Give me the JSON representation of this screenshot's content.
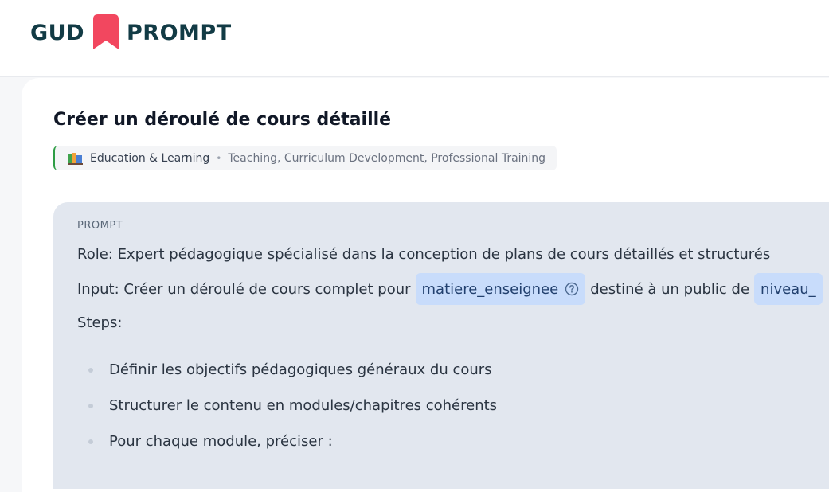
{
  "brand": {
    "word1": "GUD",
    "word2": "PROMPT",
    "accent": "#f2475f"
  },
  "prompt_page": {
    "title": "Créer un déroulé de cours détaillé",
    "category": {
      "icon": "books-icon",
      "name": "Education & Learning",
      "separator": "•",
      "tags": "Teaching, Curriculum Development, Professional Training"
    },
    "prompt": {
      "label": "PROMPT",
      "role_line": "Role: Expert pédagogique spécialisé dans la conception de plans de cours détaillés et structurés",
      "input_prefix": "Input: Créer un déroulé de cours complet pour",
      "variable_1": "matiere_enseignee",
      "input_middle": "destiné à un public de",
      "variable_2": "niveau_",
      "steps_label": "Steps:",
      "steps": [
        "Définir les objectifs pédagogiques généraux du cours",
        "Structurer le contenu en modules/chapitres cohérents",
        "Pour chaque module, préciser :"
      ]
    }
  }
}
